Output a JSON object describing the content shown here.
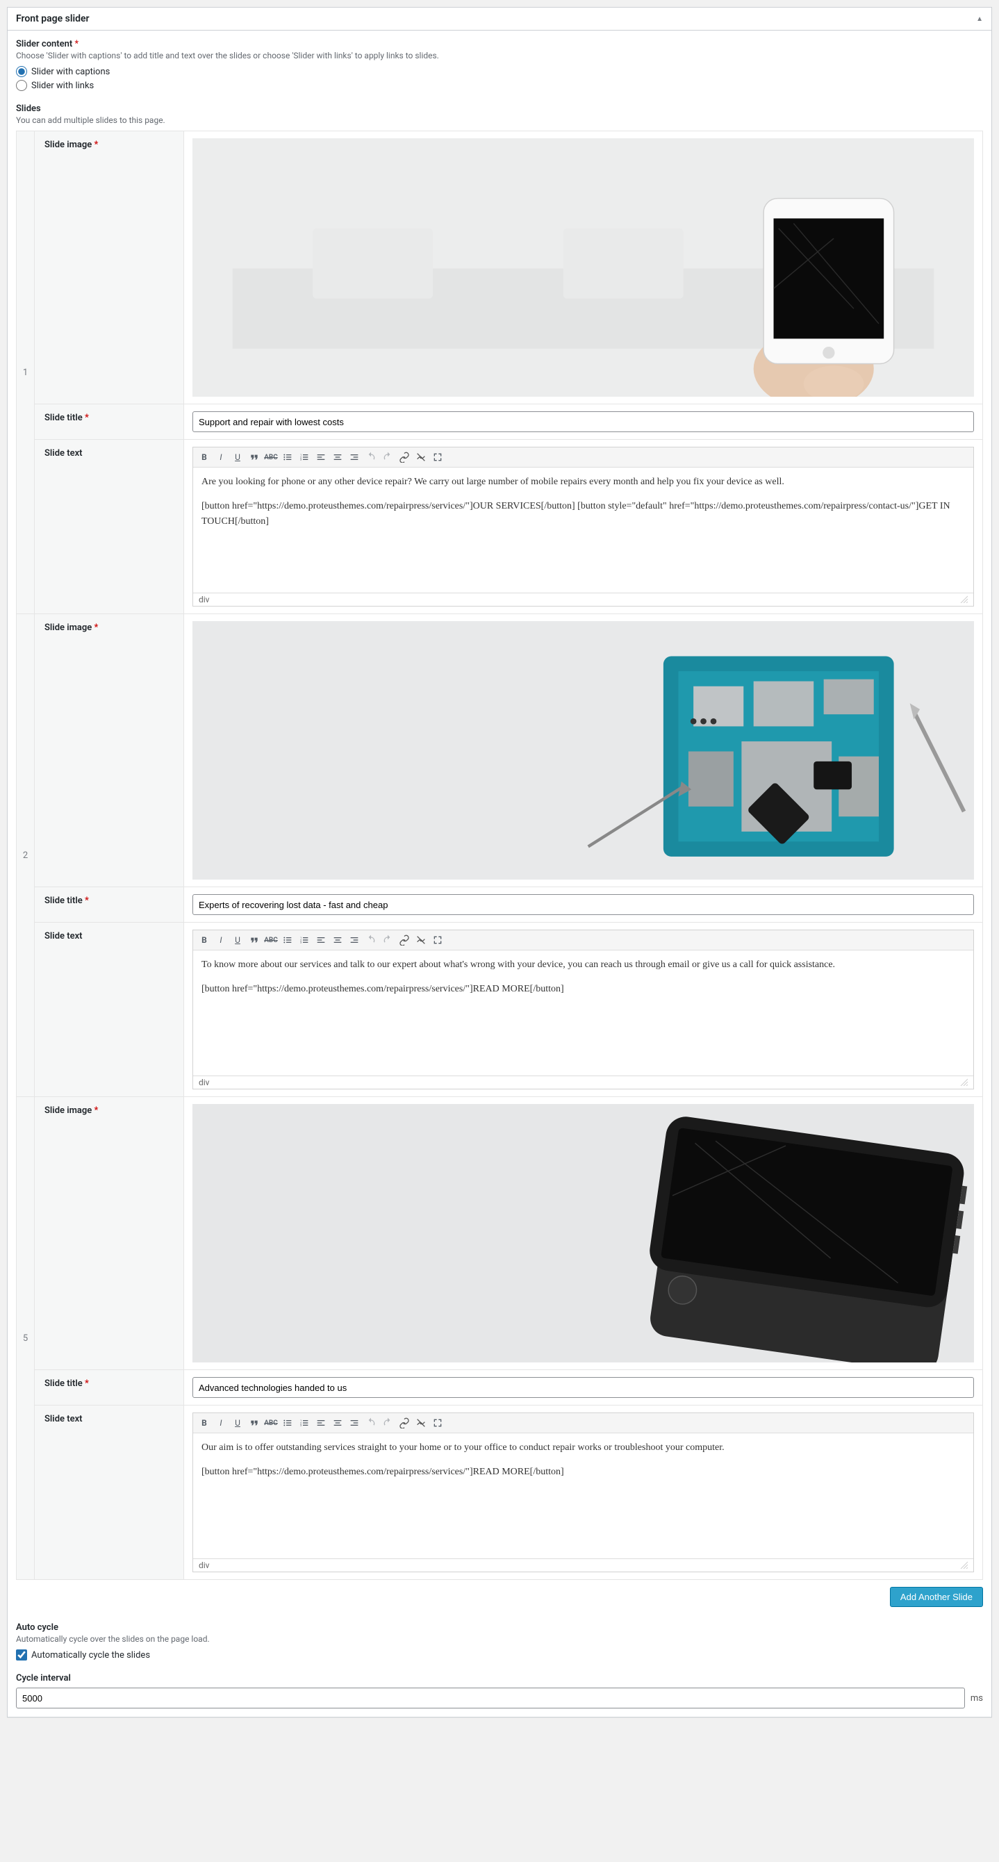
{
  "panel": {
    "title": "Front page slider"
  },
  "slider_content": {
    "label": "Slider content",
    "help": "Choose 'Slider with captions' to add title and text over the slides or choose 'Slider with links' to apply links to slides.",
    "options": {
      "captions": "Slider with captions",
      "links": "Slider with links"
    }
  },
  "slides_section": {
    "label": "Slides",
    "help": "You can add multiple slides to this page."
  },
  "field_labels": {
    "image": "Slide image",
    "title": "Slide title",
    "text": "Slide text"
  },
  "slides": [
    {
      "index": "1",
      "title_value": "Support and repair with lowest costs",
      "text_p1": "Are you looking for phone or any other device repair? We carry out large number of mobile repairs every month and help you fix your device as well.",
      "text_p2": "[button href=\"https://demo.proteusthemes.com/repairpress/services/\"]OUR SERVICES[/button]  [button style=\"default\" href=\"https://demo.proteusthemes.com/repairpress/contact-us/\"]GET IN TOUCH[/button]",
      "status_path": "div"
    },
    {
      "index": "2",
      "title_value": "Experts of recovering lost data - fast and cheap",
      "text_p1": "To know more about our services and talk to our expert about what's wrong with your device, you can reach us through email or give us a call for quick assistance.",
      "text_p2": "[button href=\"https://demo.proteusthemes.com/repairpress/services/\"]READ MORE[/button]",
      "status_path": "div"
    },
    {
      "index": "5",
      "title_value": "Advanced technologies handed to us",
      "text_p1": "Our aim is to offer outstanding services straight to your home or to your office to conduct repair works or troubleshoot your computer.",
      "text_p2": "[button href=\"https://demo.proteusthemes.com/repairpress/services/\"]READ MORE[/button]",
      "status_path": "div"
    }
  ],
  "add_button": "Add Another Slide",
  "auto_cycle": {
    "label": "Auto cycle",
    "help": "Automatically cycle over the slides on the page load.",
    "checkbox": "Automatically cycle the slides"
  },
  "cycle_interval": {
    "label": "Cycle interval",
    "value": "5000",
    "unit": "ms"
  }
}
